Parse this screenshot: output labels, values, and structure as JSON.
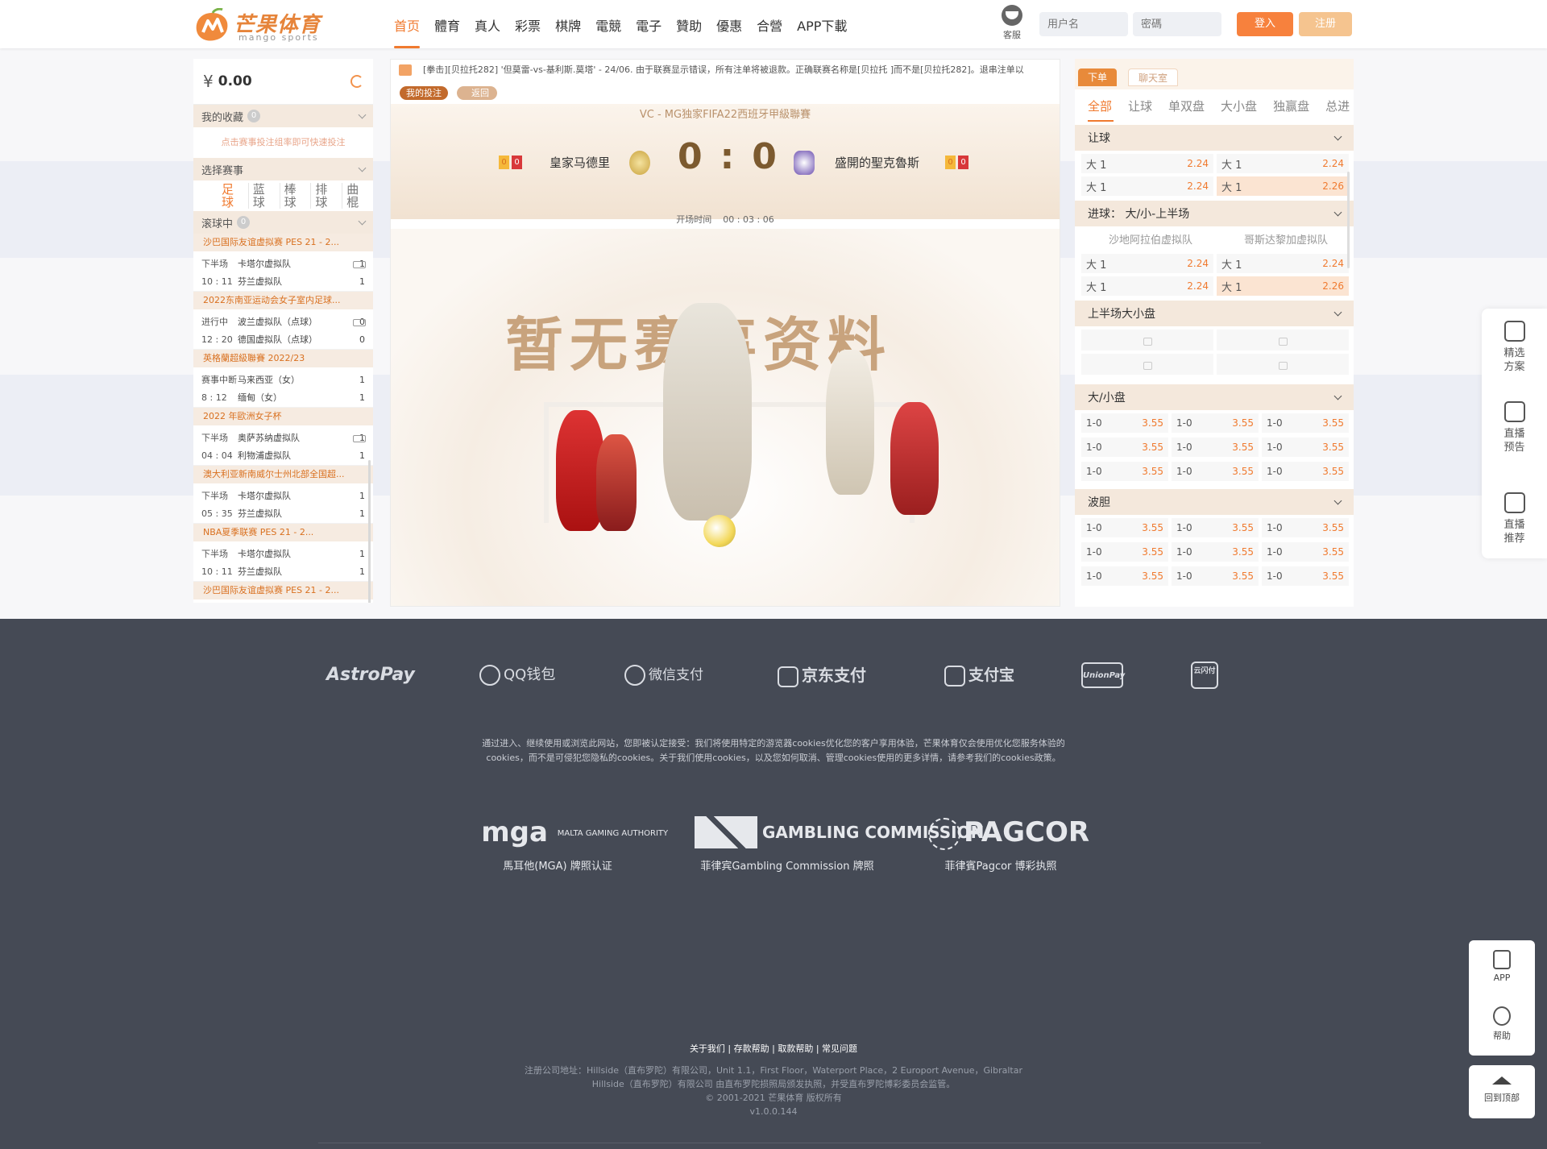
{
  "brand": {
    "name_cn": "芒果体育",
    "name_en": "mango sports",
    "accent": "#f07a2f"
  },
  "nav": [
    {
      "label": "首页",
      "active": true
    },
    {
      "label": "體育"
    },
    {
      "label": "真人"
    },
    {
      "label": "彩票"
    },
    {
      "label": "棋牌"
    },
    {
      "label": "電競"
    },
    {
      "label": "電子"
    },
    {
      "label": "贊助"
    },
    {
      "label": "優惠"
    },
    {
      "label": "合營"
    },
    {
      "label": "APP下載"
    }
  ],
  "header": {
    "support_label": "客服",
    "username_placeholder": "用户名",
    "password_placeholder": "密碼",
    "login_label": "登入",
    "register_label": "注册"
  },
  "left": {
    "currency": "¥",
    "balance": "0.00",
    "favorites": {
      "title": "我的收藏",
      "count": "0",
      "tip": "点击赛事投注组率即可快速投注"
    },
    "select_title": "选择赛事",
    "sports": [
      "足球",
      "蓝球",
      "棒球",
      "排球",
      "曲棍"
    ],
    "live": {
      "title": "滚球中",
      "count": "0"
    },
    "groups": [
      {
        "league": "沙巴国际友谊虚拟赛 PES 21 - 2...",
        "matches": [
          {
            "status": "下半场",
            "time": "10 : 11",
            "home": "卡塔尔虚拟队",
            "away": "芬兰虚拟队",
            "hs": "1",
            "as": "1",
            "live": true
          }
        ]
      },
      {
        "league": "2022东南亚运动会女子室内足球...",
        "matches": [
          {
            "status": "进行中",
            "time": "12 : 20",
            "home": "波兰虚拟队（点球）",
            "away": "德国虚拟队（点球）",
            "hs": "0",
            "as": "0",
            "live": true
          }
        ]
      },
      {
        "league": "英格蘭超級聯賽 2022/23",
        "matches": [
          {
            "status": "赛事中断",
            "time": "8 : 12",
            "home": "马来西亚（女）",
            "away": "缅甸（女）",
            "hs": "1",
            "as": "1",
            "live": false
          }
        ]
      },
      {
        "league": "2022 年歐洲女子杯",
        "matches": [
          {
            "status": "下半场",
            "time": "04 : 04",
            "home": "奥萨苏纳虚拟队",
            "away": "利物浦虚拟队",
            "hs": "1",
            "as": "1",
            "live": true
          }
        ]
      },
      {
        "league": "澳大利亚新南威尔士州北部全国超...",
        "matches": [
          {
            "status": "下半场",
            "time": "05 : 35",
            "home": "卡塔尔虚拟队",
            "away": "芬兰虚拟队",
            "hs": "1",
            "as": "1",
            "live": false
          }
        ]
      },
      {
        "league": "NBA夏季联赛 PES 21 - 2...",
        "matches": [
          {
            "status": "下半场",
            "time": "10 : 11",
            "home": "卡塔尔虚拟队",
            "away": "芬兰虚拟队",
            "hs": "1",
            "as": "1",
            "live": false
          }
        ]
      },
      {
        "league": "沙巴国际友谊虚拟赛 PES 21 - 2...",
        "matches": []
      }
    ]
  },
  "center": {
    "ticker": "[拳击][贝拉托282] '但莫雷-vs-基利斯.莫塔' - 24/06. 由于联赛显示错误，所有注单将被退款。正确联赛名称是[贝拉托 ]而不是[贝拉托282]。退串注单以",
    "my_bets": "我的投注",
    "back": "返回",
    "league_title": "VC - MG独家FIFA22西班牙甲級聯賽",
    "home": "皇家马德里",
    "away": "盛開的聖克魯斯",
    "home_cards": [
      "0",
      "0"
    ],
    "away_cards": [
      "0",
      "0"
    ],
    "score_home": "0",
    "score_away": "0",
    "kickoff_label": "开场时间",
    "kickoff_time": "00 : 03 : 06",
    "hero_text": "暂无赛事资料"
  },
  "right": {
    "tabs": [
      "下单",
      "聊天室"
    ],
    "market_tabs": [
      "全部",
      "让球",
      "单双盘",
      "大小盘",
      "独赢盘",
      "总进"
    ],
    "markets": {
      "handicap": {
        "title": "让球",
        "rows": [
          [
            {
              "l": "大 1",
              "o": "2.24"
            },
            {
              "l": "大 1",
              "o": "2.24"
            }
          ],
          [
            {
              "l": "大 1",
              "o": "2.24"
            },
            {
              "l": "大 1",
              "o": "2.26",
              "hl": true
            }
          ]
        ]
      },
      "goals_half": {
        "title": "进球： 大/小-上半场",
        "teams": [
          "沙地阿拉伯虚拟队",
          "哥斯达黎加虚拟队"
        ],
        "rows": [
          [
            {
              "l": "大 1",
              "o": "2.24"
            },
            {
              "l": "大 1",
              "o": "2.24"
            }
          ],
          [
            {
              "l": "大 1",
              "o": "2.24"
            },
            {
              "l": "大 1",
              "o": "2.26",
              "hl": true
            }
          ]
        ]
      },
      "half_ou": {
        "title": "上半场大小盘"
      },
      "ou": {
        "title": "大/小盘",
        "cell": {
          "l": "1-0",
          "o": "3.55"
        }
      },
      "cs": {
        "title": "波胆",
        "cell": {
          "l": "1-0",
          "o": "3.55"
        }
      }
    }
  },
  "side": {
    "items": [
      "精选\n方案",
      "直播\n预告",
      "直播\n推荐"
    ],
    "app": "APP",
    "help": "帮助",
    "top": "回到顶部"
  },
  "footer": {
    "payments": [
      "AstroPay",
      "QQ钱包",
      "微信支付",
      "京东支付",
      "支付宝",
      "UnionPay",
      "云闪付"
    ],
    "cookie_line1": "通过进入、继续使用或浏览此网站，您即被认定接受：我们将使用特定的游览器cookies优化您的客户享用体验，芒果体育仅会使用优化您服务体验的",
    "cookie_line2": "cookies，而不是可侵犯您隐私的cookies。关于我们使用cookies，以及您如何取消、管理cookies使用的更多详情，请参考我们的cookies政策。",
    "licenses": [
      {
        "logo": "mga",
        "sub": "MALTA GAMING AUTHORITY",
        "caption": "馬耳他(MGA) 牌照认证"
      },
      {
        "logo": "GAMBLING COMMISSION",
        "caption": "菲律宾Gambling Commission 牌照"
      },
      {
        "logo": "PAGCOR",
        "caption": "菲律賓Pagcor 博彩执照"
      }
    ],
    "links": "关于我们 | 存款帮助 | 取款帮助 | 常见问题",
    "company1": "注册公司地址：Hillside（直布罗陀）有限公司，Unit 1.1，First Floor，Waterport Place，2 Europort Avenue，Gibraltar",
    "company2": "Hillside（直布罗陀）有限公司 由直布罗陀损照局颁发执照，并受直布罗陀博彩委员会监管。",
    "copyright": "© 2001-2021 芒果体育 版权所有",
    "version": "v1.0.0.144"
  }
}
